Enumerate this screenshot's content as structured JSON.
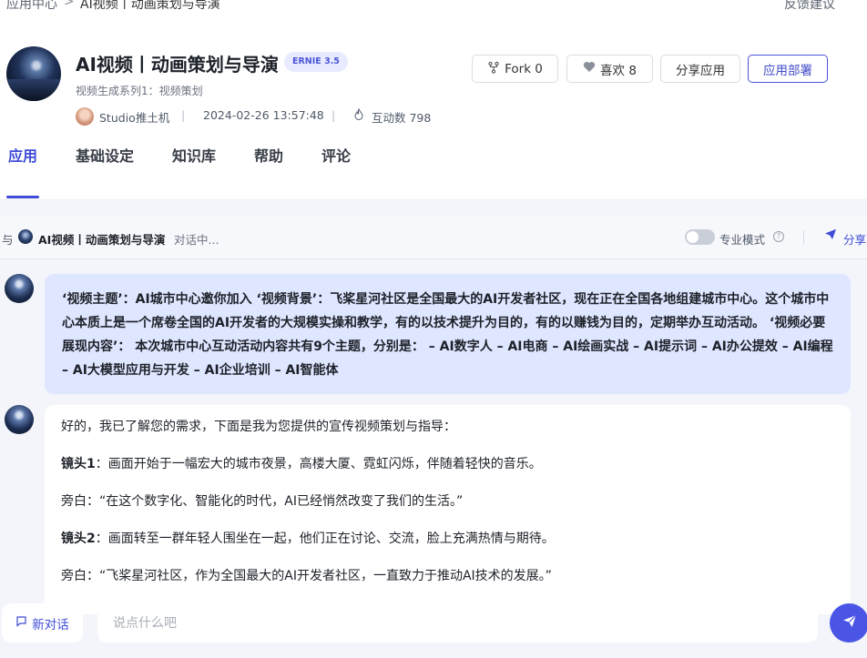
{
  "breadcrumb": {
    "root": "应用中心",
    "separator": ">",
    "current": "AI视频丨动画策划与导演",
    "feedback": "反馈建议"
  },
  "app": {
    "title": "AI视频丨动画策划与导演",
    "model_badge": "ERNIE 3.5",
    "subtitle": "视频生成系列1：视频策划",
    "author": "Studio推土机",
    "date": "2024-02-26 13:57:48",
    "interactions": "互动数 798",
    "separator": "|"
  },
  "actions": {
    "fork": "Fork 0",
    "like": "喜欢 8",
    "share": "分享应用",
    "deploy": "应用部署"
  },
  "tabs": [
    {
      "label": "应用"
    },
    {
      "label": "基础设定"
    },
    {
      "label": "知识库"
    },
    {
      "label": "帮助"
    },
    {
      "label": "评论"
    }
  ],
  "chat_bar": {
    "with": "与",
    "name": "AI视频丨动画策划与导演",
    "status": "对话中...",
    "pro_mode": "专业模式",
    "share": "分享"
  },
  "user_message": "‘视频主题’：AI城市中心邀你加入 ‘视频背景’：飞桨星河社区是全国最大的AI开发者社区，现在正在全国各地组建城市中心。这个城市中心本质上是一个席卷全国的AI开发者的大规模实操和教学，有的以技术提升为目的，有的以赚钱为目的，定期举办互动活动。 ‘视频必要展现内容’： 本次城市中心互动活动内容共有9个主题，分别是： – AI数字人 – AI电商 – AI绘画实战 – AI提示词 – AI办公提效 – AI编程 – AI大模型应用与开发 – AI企业培训 – AI智能体",
  "bot_message": {
    "intro": "好的，我已了解您的需求，下面是我为您提供的宣传视频策划与指导：",
    "shot1_label": "镜头1",
    "shot1_text": "：画面开始于一幅宏大的城市夜景，高楼大厦、霓虹闪烁，伴随着轻快的音乐。",
    "narration1": "旁白：“在这个数字化、智能化的时代，AI已经悄然改变了我们的生活。”",
    "shot2_label": "镜头2",
    "shot2_text": "：画面转至一群年轻人围坐在一起，他们正在讨论、交流，脸上充满热情与期待。",
    "narration2": "旁白：“飞桨星河社区，作为全国最大的AI开发者社区，一直致力于推动AI技术的发展。”"
  },
  "composer": {
    "new_chat": "新对话",
    "placeholder": "说点什么吧"
  },
  "colors": {
    "accent": "#3e4bd6",
    "user_bubble": "#dfe6ff",
    "panel_bg": "#f3f5fa"
  }
}
